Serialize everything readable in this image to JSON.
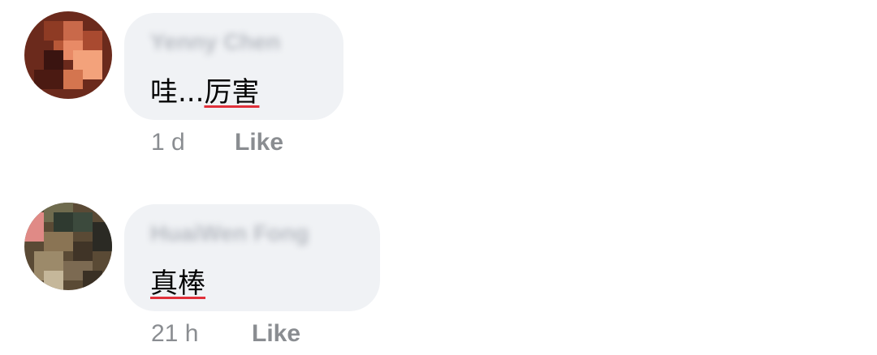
{
  "comments": [
    {
      "author": "Yenny Chen",
      "text_prefix": "哇...",
      "text_flagged": "厉害",
      "time": "1 d",
      "like_label": "Like"
    },
    {
      "author": "HuaiWen Fong",
      "text_prefix": "",
      "text_flagged": "真棒",
      "time": "21 h",
      "like_label": "Like"
    }
  ]
}
